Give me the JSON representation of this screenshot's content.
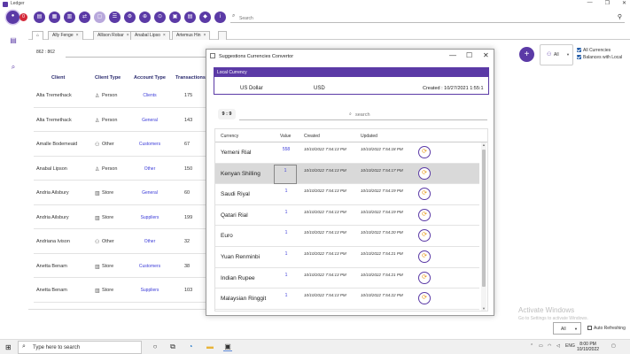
{
  "app": {
    "title": "Ledger"
  },
  "window_controls": {
    "minimize": "—",
    "restore": "❐",
    "close": "✕"
  },
  "toolbar": {
    "badge_count": "0",
    "buttons": [
      "▤",
      "▦",
      "▥",
      "⇄",
      "▢",
      "☰",
      "⚙",
      "⊕",
      "⊙",
      "▣",
      "▤",
      "◆",
      "i"
    ],
    "search_placeholder": "Search",
    "search_icon": "search-icon"
  },
  "tabs": [
    {
      "label": "⌂",
      "closable": false
    },
    {
      "label": "Ally Fenge",
      "closable": true
    },
    {
      "label": "Allison Robar",
      "closable": true
    },
    {
      "label": "Anabal Lipso",
      "closable": true
    },
    {
      "label": "Artemus Hin",
      "closable": true
    },
    {
      "label": "",
      "closable": false
    }
  ],
  "filter": {
    "ratio": "862 : 862"
  },
  "controls": {
    "add_label": "+",
    "dropdown_label": "All",
    "all_currencies": "All Currencies",
    "balances_with_local": "Balances with Local"
  },
  "main_table": {
    "headers": {
      "client": "Client",
      "client_type": "Client Type",
      "account_type": "Account Type",
      "transactions": "Transactions"
    },
    "rows": [
      {
        "client": "Alta Tremethack",
        "type_icon": "person-icon",
        "glyph": "♙",
        "client_type": "Person",
        "account_type": "Clients",
        "transactions": "175"
      },
      {
        "client": "Alta Tremethack",
        "type_icon": "person-icon",
        "glyph": "♙",
        "client_type": "Person",
        "account_type": "General",
        "transactions": "143"
      },
      {
        "client": "Amalle Bodemeaid",
        "type_icon": "other-icon",
        "glyph": "⚇",
        "client_type": "Other",
        "account_type": "Customers",
        "transactions": "67"
      },
      {
        "client": "Anabal Lipson",
        "type_icon": "person-icon",
        "glyph": "♙",
        "client_type": "Person",
        "account_type": "Other",
        "transactions": "150"
      },
      {
        "client": "Andria Ailsbury",
        "type_icon": "store-icon",
        "glyph": "▥",
        "client_type": "Store",
        "account_type": "General",
        "transactions": "60"
      },
      {
        "client": "Andria Ailsbury",
        "type_icon": "store-icon",
        "glyph": "▥",
        "client_type": "Store",
        "account_type": "Suppliers",
        "transactions": "199"
      },
      {
        "client": "Andriana Ivison",
        "type_icon": "other-icon",
        "glyph": "⚇",
        "client_type": "Other",
        "account_type": "Other",
        "transactions": "32"
      },
      {
        "client": "Anetta Benam",
        "type_icon": "store-icon",
        "glyph": "▥",
        "client_type": "Store",
        "account_type": "Customers",
        "transactions": "38"
      },
      {
        "client": "Anetta Benam",
        "type_icon": "store-icon",
        "glyph": "▥",
        "client_type": "Store",
        "account_type": "Suppliers",
        "transactions": "103"
      }
    ]
  },
  "dialog": {
    "title": "Suggestions Currencies Convertor",
    "local_currency": {
      "header": "Local Currency",
      "name": "US Dollar",
      "code": "USD",
      "created": "Created : 10/27/2021 1:55:1"
    },
    "ratio": "9 : 9",
    "search_placeholder": "search",
    "headers": {
      "currency": "Currency",
      "value": "Value",
      "created": "Created",
      "updated": "Updated"
    },
    "rows": [
      {
        "currency": "Yemeni Rial",
        "value": "558",
        "created": "10/10/2022 7:54:13 PM",
        "updated": "10/10/2022 7:54:18 PM"
      },
      {
        "currency": "Kenyan Shilling",
        "value": "1",
        "created": "10/10/2022 7:54:13 PM",
        "updated": "10/10/2022 7:54:17 PM"
      },
      {
        "currency": "Saudi Riyal",
        "value": "1",
        "created": "10/10/2022 7:54:13 PM",
        "updated": "10/10/2022 7:54:19 PM"
      },
      {
        "currency": "Qatari Rial",
        "value": "1",
        "created": "10/10/2022 7:54:13 PM",
        "updated": "10/10/2022 7:54:19 PM"
      },
      {
        "currency": "Euro",
        "value": "1",
        "created": "10/10/2022 7:54:13 PM",
        "updated": "10/10/2022 7:54:20 PM"
      },
      {
        "currency": "Yuan Renminbi",
        "value": "1",
        "created": "10/10/2022 7:54:13 PM",
        "updated": "10/10/2022 7:54:21 PM"
      },
      {
        "currency": "Indian Rupee",
        "value": "1",
        "created": "10/10/2022 7:54:13 PM",
        "updated": "10/10/2022 7:54:21 PM"
      },
      {
        "currency": "Malaysian Ringgit",
        "value": "1",
        "created": "10/10/2022 7:54:13 PM",
        "updated": "10/10/2022 7:54:22 PM"
      }
    ]
  },
  "bottom": {
    "activate_title": "Activate Windows",
    "activate_sub": "Go to Settings to activate Windows.",
    "filter_label": "All",
    "auto_refresh": "Auto Refreshing"
  },
  "taskbar": {
    "search_placeholder": "Type here to search",
    "language": "ENG",
    "time": "8:00 PM",
    "date": "10/10/2022"
  },
  "colors": {
    "brand": "#5b3aa6",
    "badge": "#d4293a",
    "link": "#3b3bd8",
    "refresh": "#e69a1a"
  }
}
